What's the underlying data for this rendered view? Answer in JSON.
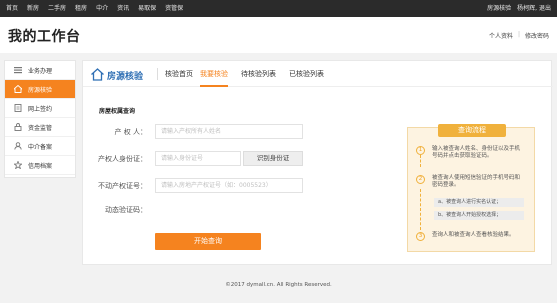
{
  "topnav": {
    "items": [
      "首页",
      "新房",
      "二手房",
      "租房",
      "中介",
      "资讯",
      "易取保",
      "资管保"
    ],
    "user": "房源核验",
    "welcome": "杨柯辉, 退出"
  },
  "header": {
    "title": "我的工作台",
    "link_profile": "个人资料",
    "link_password": "修改密码"
  },
  "sidebar": {
    "items": [
      {
        "label": "业务办理",
        "icon": "menu-icon"
      },
      {
        "label": "房源核验",
        "icon": "house-icon"
      },
      {
        "label": "网上签约",
        "icon": "document-icon"
      },
      {
        "label": "资金监管",
        "icon": "lock-icon"
      },
      {
        "label": "中介备案",
        "icon": "user-icon"
      },
      {
        "label": "信用档案",
        "icon": "star-icon"
      }
    ],
    "active_index": 1
  },
  "tabs": {
    "brand": "房源核验",
    "items": [
      "核验首页",
      "我要核验",
      "待核验列表",
      "已核验列表"
    ],
    "active_index": 1
  },
  "form": {
    "section_title": "房屋权属查询",
    "owner_label": "产 权 人：",
    "owner_placeholder": "请输入产权所有人姓名",
    "id_label": "产权人身份证：",
    "id_placeholder": "请输入身份证号",
    "id_button": "识别身份证",
    "cert_label": "不动产权证号：",
    "cert_placeholder": "请输入房地产产权证号（如：0005523）",
    "code_label": "动态验证码：",
    "submit": "开始查询"
  },
  "panel": {
    "title": "查询流程",
    "steps": [
      {
        "num": "1",
        "text": "输入被查询人姓名、身份证以及手机号码并点击获取验证码。"
      },
      {
        "num": "2",
        "text": "被查询人使用短信验证的手机号码和密码登录。"
      },
      {
        "num": "3",
        "text": "查询人和被查询人查看核验结果。"
      }
    ],
    "sub_a": "a、被查询人进行实名认证；",
    "sub_b": "b、被查询人开始授权选择；"
  },
  "footer": {
    "copyright": "©2017 dymall.cn. All Rights Reserved."
  },
  "colors": {
    "accent": "#f5831f",
    "brand_blue": "#2f6fb4",
    "panel_bg": "#fdf3e1",
    "topbar": "#2b2b2b"
  }
}
